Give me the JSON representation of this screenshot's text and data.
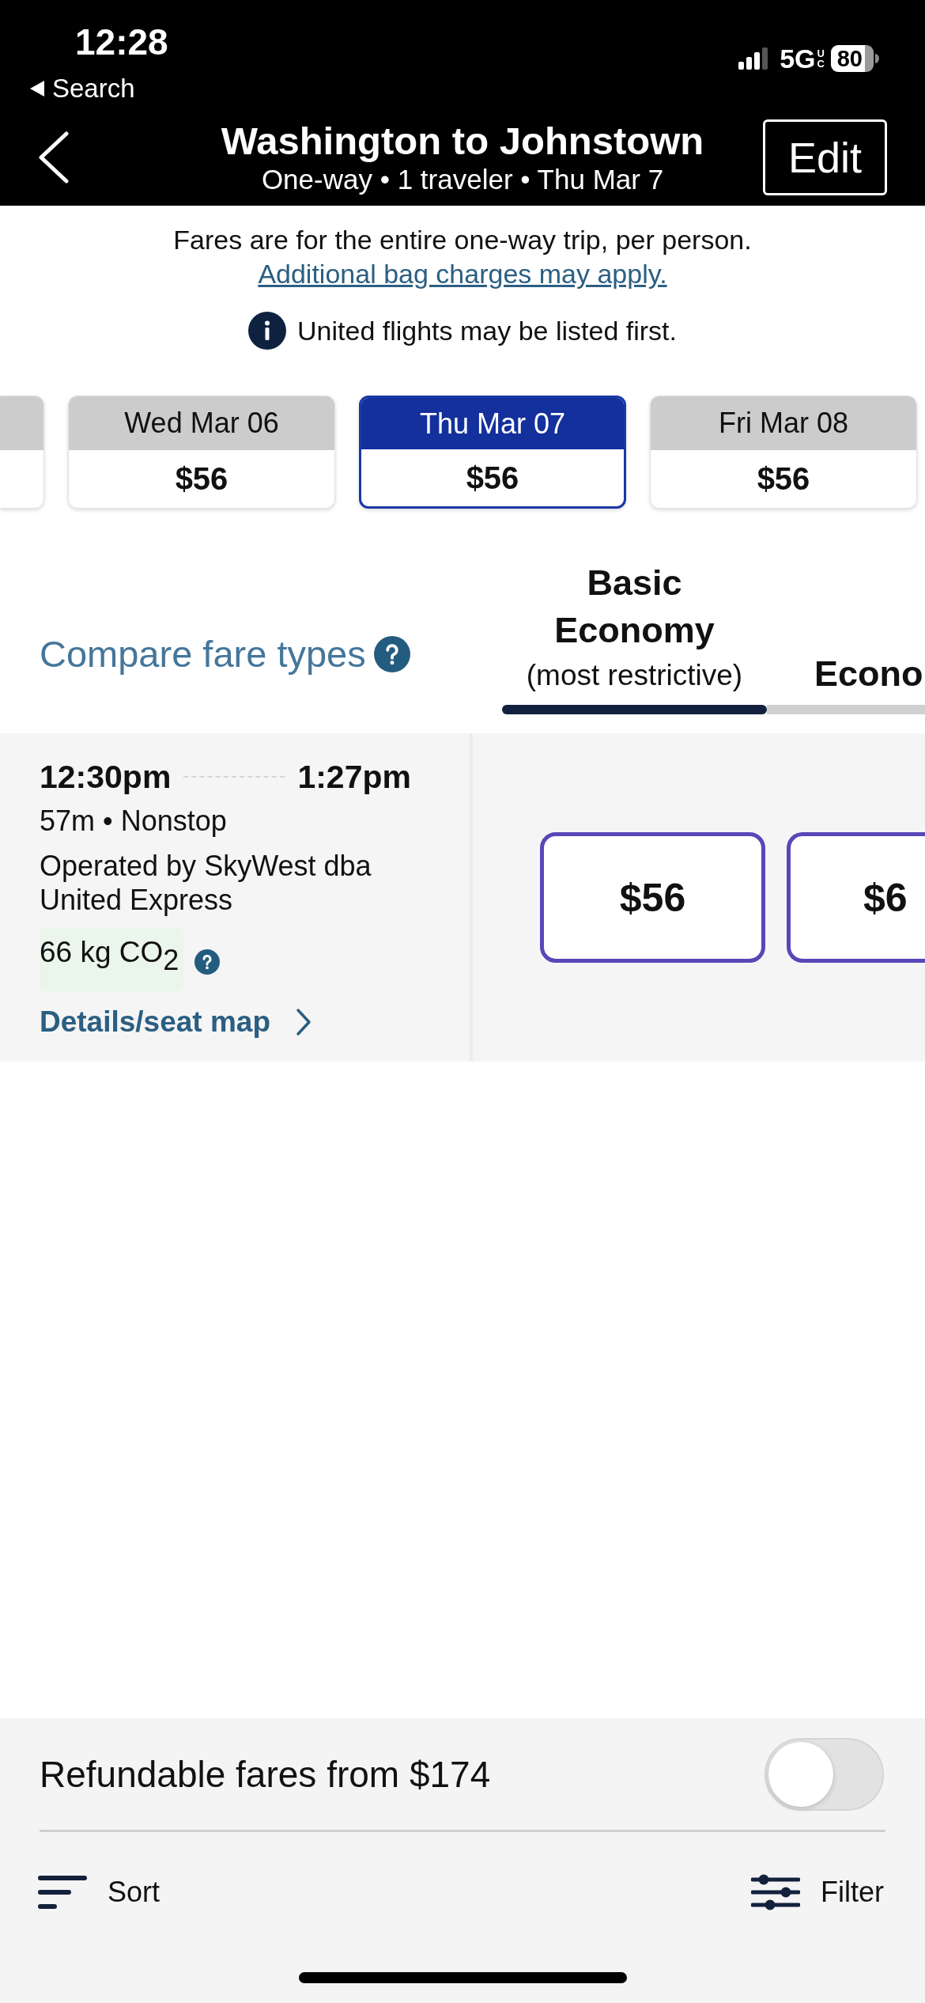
{
  "status_bar": {
    "time": "12:28",
    "back_label": "Search",
    "network": "5G",
    "network_mark": "UC",
    "battery": "80"
  },
  "header": {
    "title": "Washington to Johnstown",
    "subtitle": "One-way • 1 traveler • Thu Mar 7",
    "edit_button": "Edit"
  },
  "notice": {
    "text": "Fares are for the entire one-way trip, per person.",
    "link": "Additional bag charges may apply."
  },
  "info": "United flights may be listed first.",
  "dates": [
    {
      "kind": "clipped",
      "selected": false
    },
    {
      "kind": "full",
      "date": "Wed Mar 06",
      "price": "$56",
      "selected": false
    },
    {
      "kind": "full",
      "date": "Thu Mar 07",
      "price": "$56",
      "selected": true
    },
    {
      "kind": "full",
      "date": "Fri Mar 08",
      "price": "$56",
      "selected": false
    }
  ],
  "compare_link": "Compare fare types",
  "fare_columns": [
    {
      "title": "Basic Economy",
      "note": "(most restrictive)",
      "selected": true
    },
    {
      "title": "Econo",
      "selected": false
    }
  ],
  "flights": [
    {
      "depart": "12:30pm",
      "arrive": "1:27pm",
      "summary": "57m • Nonstop",
      "operator": "Operated by SkyWest dba United Express",
      "emissions": "66 kg CO$_{2}$",
      "details_link": "Details/seat map",
      "fares": [
        {
          "kind": "full",
          "price": "$56"
        },
        {
          "kind": "clipped",
          "price": "$6"
        }
      ]
    }
  ],
  "refundable": {
    "label": "Refundable fares from $174",
    "on": false
  },
  "toolbar": {
    "sort": "Sort",
    "filter": "Filter"
  }
}
